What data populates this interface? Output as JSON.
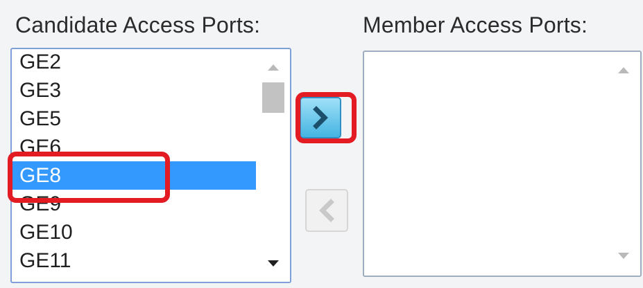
{
  "candidate": {
    "label": "Candidate Access Ports:",
    "ports": [
      {
        "label": "GE2",
        "selected": false
      },
      {
        "label": "GE3",
        "selected": false
      },
      {
        "label": "GE5",
        "selected": false
      },
      {
        "label": "GE6",
        "selected": false
      },
      {
        "label": "GE8",
        "selected": true
      },
      {
        "label": "GE9",
        "selected": false
      },
      {
        "label": "GE10",
        "selected": false
      },
      {
        "label": "GE11",
        "selected": false
      }
    ]
  },
  "member": {
    "label": "Member Access Ports:",
    "ports": []
  },
  "buttons": {
    "add_icon": "chevron-right-icon",
    "remove_icon": "chevron-left-icon"
  },
  "colors": {
    "selection": "#3399ff",
    "highlight": "#e31b23",
    "add_button": "#45b4e2"
  }
}
